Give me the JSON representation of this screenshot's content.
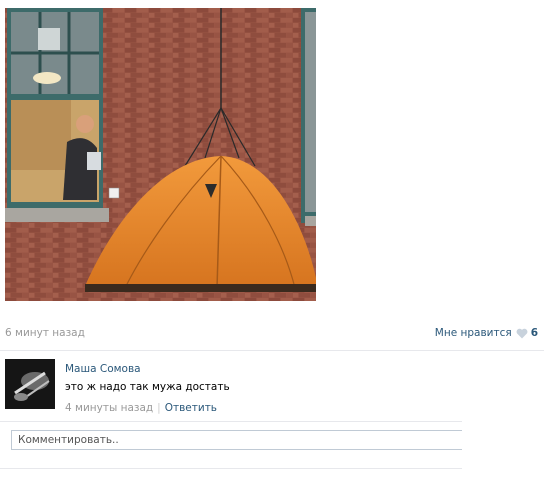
{
  "post": {
    "photo_alt": "man pouring coffee from window into tent hanging on brick wall",
    "timestamp": "6 минут назад",
    "like_label": "Мне нравится",
    "like_count": "6"
  },
  "comment": {
    "author": "Маша Сомова",
    "text": "это ж надо так мужа достать",
    "time": "4 минуты назад",
    "reply_label": "Ответить"
  },
  "composer": {
    "placeholder": "Комментировать.."
  },
  "colors": {
    "link": "#2b587a",
    "muted": "#999999",
    "tent": "#e8872e",
    "brick": "#8b4a3b"
  }
}
